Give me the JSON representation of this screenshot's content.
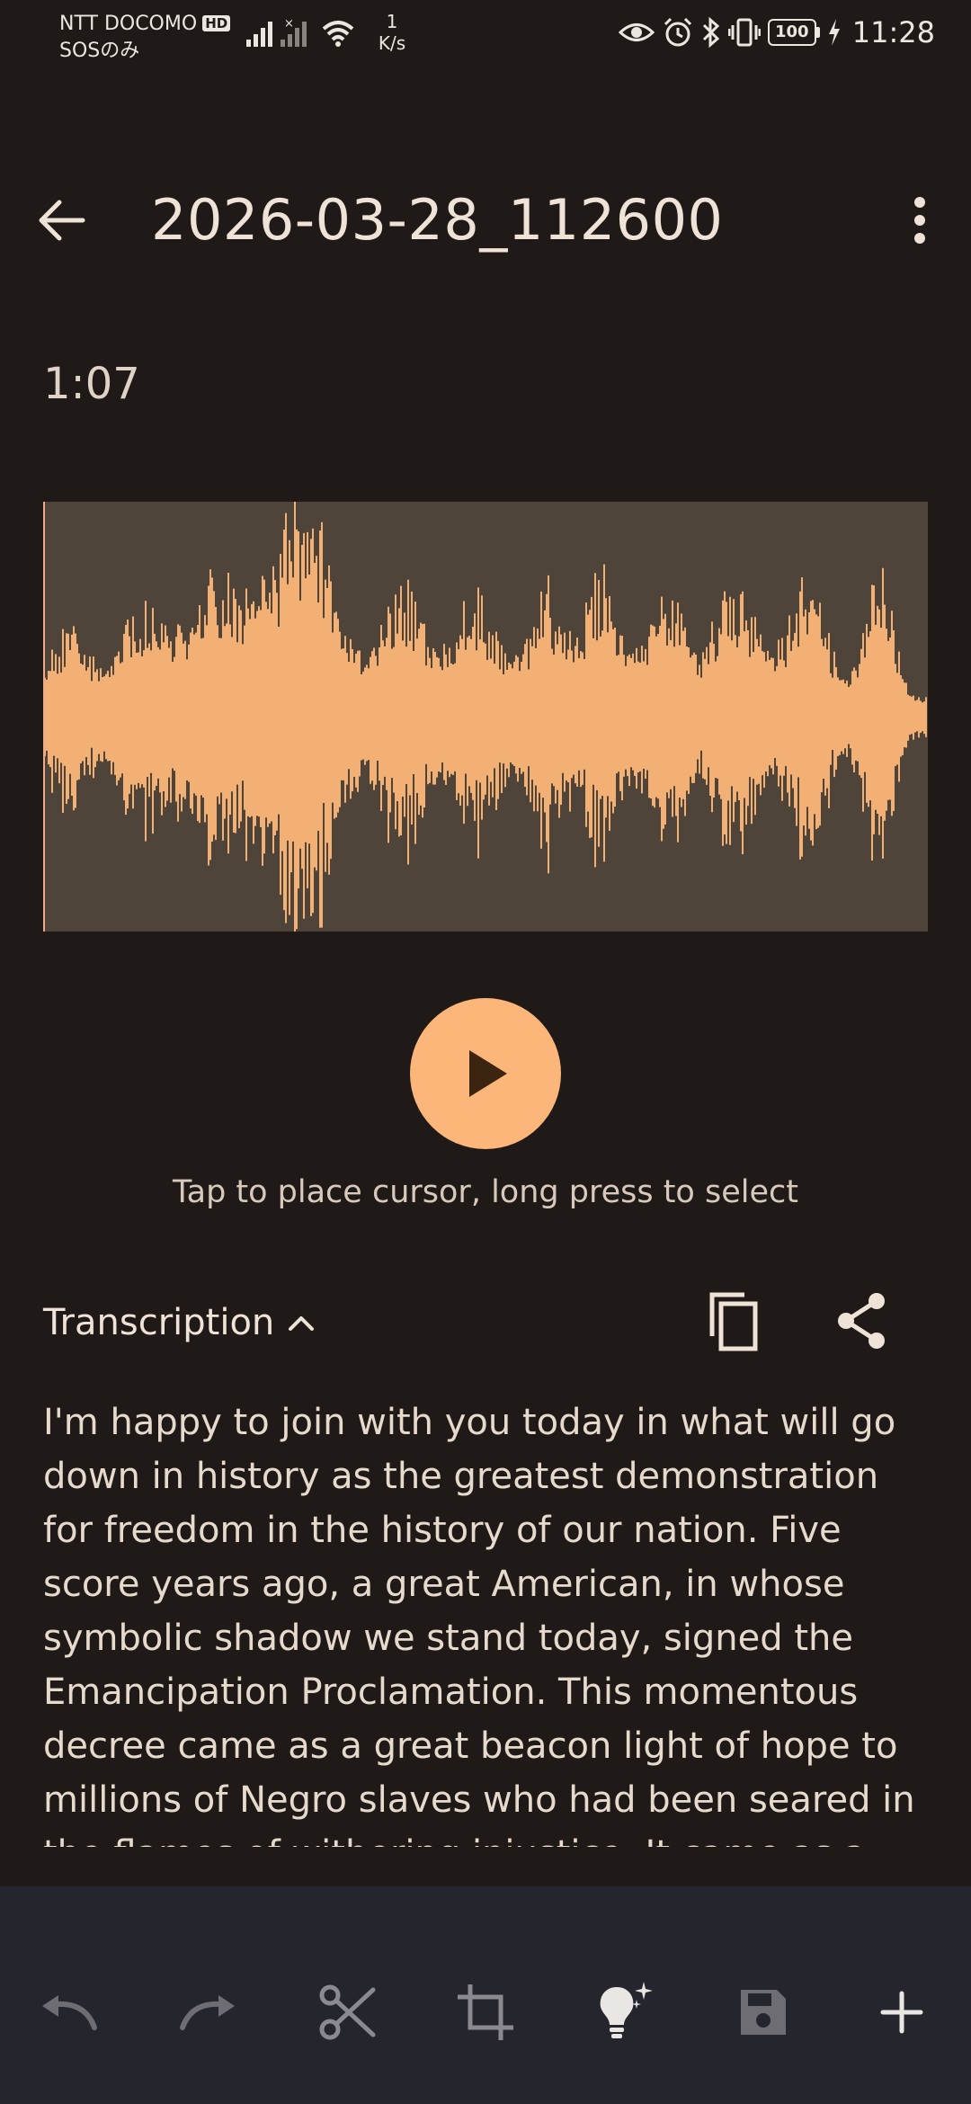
{
  "status_bar": {
    "carrier_line1": "NTT DOCOMO",
    "carrier_badge": "HD",
    "carrier_line2": "SOSのみ",
    "netspeed_value": "1",
    "netspeed_unit": "K/s",
    "battery": "100",
    "time": "11:28"
  },
  "app_bar": {
    "title": "2026-03-28_112600",
    "back_icon": "arrow-back-icon",
    "menu_icon": "more-vert-icon"
  },
  "player": {
    "duration": "1:07",
    "hint": "Tap to place cursor, long press to select",
    "play_icon": "play-icon"
  },
  "transcription": {
    "label": "Transcription",
    "text": "I'm happy to join with you today in what will go down in history as the greatest demonstration for freedom in the history of our nation. Five score years ago, a great American, in whose symbolic shadow we stand today, signed the Emancipation Proclamation. This momentous decree came as a great beacon light of hope to millions of Negro slaves who had been seared in the flames of withering injustice. It came as a joyous daybreak to end the long night of their captivity."
  },
  "colors": {
    "background": "#1f1a17",
    "accent": "#fdb67a",
    "waveform_bg": "#4f443a",
    "toolbar_bg": "#25252d"
  },
  "toolbar": {
    "items": [
      "undo-icon",
      "redo-icon",
      "cut-icon",
      "crop-icon",
      "lightbulb-sparkle-icon",
      "save-icon",
      "add-icon"
    ]
  }
}
